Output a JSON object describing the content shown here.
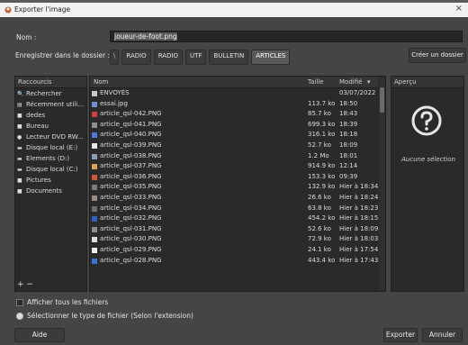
{
  "window": {
    "title": "Exporter l'image",
    "close_glyph": "×"
  },
  "form": {
    "name_label": "Nom :",
    "name_value": "joueur-de-foot.png",
    "folder_label": "Enregistrer dans le dossier :",
    "crumbs": [
      "\\",
      "RADIO",
      "RADIO",
      "UTF",
      "BULLETIN",
      "ARTICLES"
    ],
    "create_folder": "Créer un dossier"
  },
  "places": {
    "header": "Raccourcis",
    "items": [
      {
        "icon": "search-icon",
        "label": "Rechercher"
      },
      {
        "icon": "recent-icon",
        "label": "Récemment utili..."
      },
      {
        "icon": "folder-icon",
        "label": "dedes"
      },
      {
        "icon": "folder-icon",
        "label": "Bureau"
      },
      {
        "icon": "dvd-icon",
        "label": "Lecteur DVD RW..."
      },
      {
        "icon": "drive-icon",
        "label": "Disque local (E:)"
      },
      {
        "icon": "drive-icon",
        "label": "Elements (D:)"
      },
      {
        "icon": "drive-icon",
        "label": "Disque local (C:)"
      },
      {
        "icon": "folder-icon",
        "label": "Pictures"
      },
      {
        "icon": "folder-icon",
        "label": "Documents"
      }
    ],
    "add_remove": "+ −"
  },
  "files": {
    "headers": {
      "name": "Nom",
      "size": "Taille",
      "modified": "Modifié"
    },
    "rows": [
      {
        "name": "ENVOYÉS",
        "size": "",
        "date": "03/07/2022",
        "color": "#c9c9c9"
      },
      {
        "name": "essai.jpg",
        "size": "113.7 ko",
        "date": "18:50",
        "color": "#6c8fd6"
      },
      {
        "name": "article_qsl-042.PNG",
        "size": "85.7 ko",
        "date": "18:43",
        "color": "#d04040"
      },
      {
        "name": "article_qsl-041.PNG",
        "size": "699.3 ko",
        "date": "18:39",
        "color": "#8f8f8f"
      },
      {
        "name": "article_qsl-040.PNG",
        "size": "316.1 ko",
        "date": "18:18",
        "color": "#4f79d9"
      },
      {
        "name": "article_qsl-039.PNG",
        "size": "52.7 ko",
        "date": "18:09",
        "color": "#e8e8e8"
      },
      {
        "name": "article_qsl-038.PNG",
        "size": "1.2 Mo",
        "date": "18:01",
        "color": "#8a9bb8"
      },
      {
        "name": "article_qsl-037.PNG",
        "size": "914.9 ko",
        "date": "12:14",
        "color": "#d9a050"
      },
      {
        "name": "article_qsl-036.PNG",
        "size": "153.3 ko",
        "date": "09:39",
        "color": "#c85a3a"
      },
      {
        "name": "article_qsl-035.PNG",
        "size": "132.9 ko",
        "date": "Hier à 18:34",
        "color": "#7a7a7a"
      },
      {
        "name": "article_qsl-033.PNG",
        "size": "26.6 ko",
        "date": "Hier à 18:24",
        "color": "#9a8a7a"
      },
      {
        "name": "article_qsl-034.PNG",
        "size": "63.8 ko",
        "date": "Hier à 18:23",
        "color": "#6f6f6f"
      },
      {
        "name": "article_qsl-032.PNG",
        "size": "454.2 ko",
        "date": "Hier à 18:15",
        "color": "#3060c0"
      },
      {
        "name": "article_qsl-031.PNG",
        "size": "52.6 ko",
        "date": "Hier à 18:09",
        "color": "#8d8d8d"
      },
      {
        "name": "article_qsl-030.PNG",
        "size": "72.9 ko",
        "date": "Hier à 18:03",
        "color": "#dedede"
      },
      {
        "name": "article_qsl-029.PNG",
        "size": "24.1 ko",
        "date": "Hier à 17:54",
        "color": "#f0f0f0"
      },
      {
        "name": "article_qsl-028.PNG",
        "size": "443.4 ko",
        "date": "Hier à 17:43",
        "color": "#4070d0"
      }
    ]
  },
  "preview": {
    "header": "Aperçu",
    "empty": "Aucune sélection"
  },
  "options": {
    "show_all": "Afficher tous les fichiers",
    "select_type": "Sélectionner le type de fichier (Selon l'extension)"
  },
  "buttons": {
    "help": "Aide",
    "export": "Exporter",
    "cancel": "Annuler"
  },
  "colors": {
    "background": "#454545",
    "pane": "#2a2a2a",
    "accent_folder": "#c9c9c9"
  }
}
